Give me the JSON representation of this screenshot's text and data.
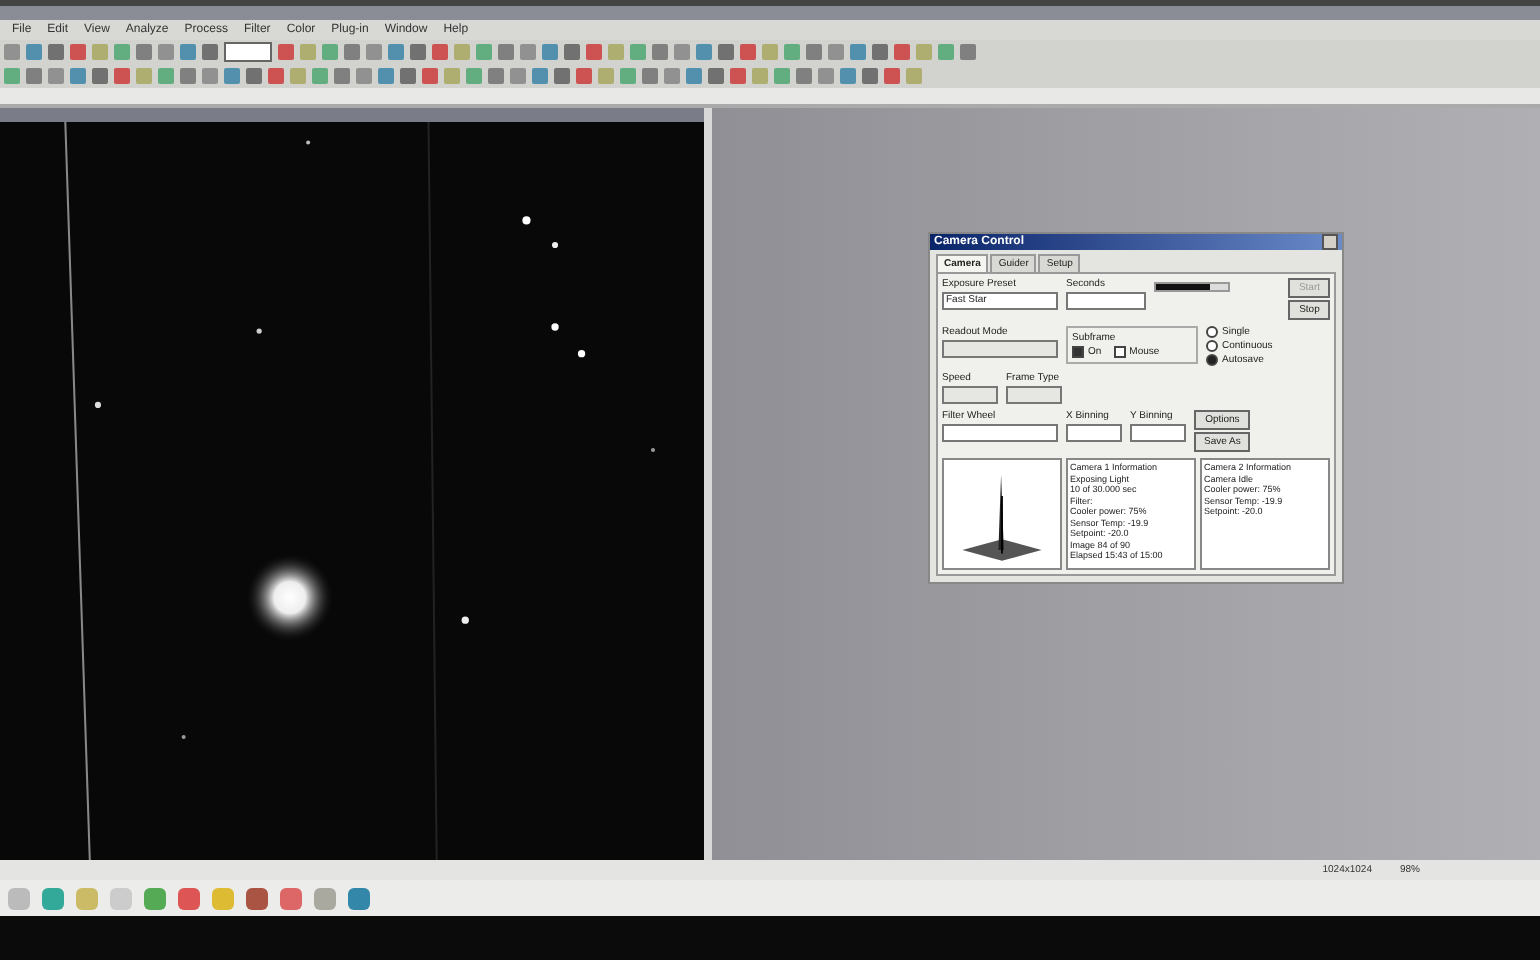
{
  "menu": [
    "File",
    "Edit",
    "View",
    "Analyze",
    "Process",
    "Filter",
    "Color",
    "Plug-in",
    "Window",
    "Help"
  ],
  "camera_dialog": {
    "title": "Camera Control",
    "tabs": [
      {
        "label": "Camera",
        "selected": true
      },
      {
        "label": "Guider",
        "selected": false
      },
      {
        "label": "Setup",
        "selected": false
      }
    ],
    "exposure_preset": {
      "label": "Exposure Preset",
      "value": "Fast Star"
    },
    "seconds": {
      "label": "Seconds",
      "level": 0.75
    },
    "readout_mode": {
      "label": "Readout Mode"
    },
    "subframe": {
      "label": "Subframe",
      "options": [
        {
          "label": "On",
          "checked": true
        },
        {
          "label": "Mouse",
          "checked": false
        }
      ]
    },
    "speed": {
      "label": "Speed"
    },
    "frame_type": {
      "label": "Frame Type"
    },
    "filter_wheel": {
      "label": "Filter Wheel"
    },
    "x_binning": {
      "label": "X Binning"
    },
    "y_binning": {
      "label": "Y Binning"
    },
    "buttons": [
      {
        "label": "Start",
        "disabled": true
      },
      {
        "label": "Stop",
        "disabled": false
      }
    ],
    "modes": [
      {
        "label": "Single",
        "selected": false
      },
      {
        "label": "Continuous",
        "selected": false
      },
      {
        "label": "Autosave",
        "selected": true
      }
    ],
    "options_button": "Options",
    "save_button": "Save As",
    "info_1": [
      "Camera 1 Information",
      "Exposing Light",
      "10 of 30.000 sec",
      "Filter:",
      "Cooler power: 75%",
      "Sensor Temp: -19.9",
      "Setpoint: -20.0",
      "Image 84 of 90",
      "Elapsed 15:43 of 15:00"
    ],
    "info_2": [
      "Camera 2 Information",
      "Camera Idle",
      "Cooler power: 75%",
      "Sensor Temp: -19.9",
      "Setpoint: -20.0"
    ]
  },
  "status_bar": {
    "readings": [
      "1024x1024",
      "98%"
    ]
  }
}
